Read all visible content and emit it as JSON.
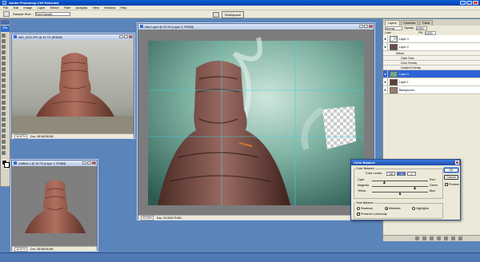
{
  "app": {
    "title": "Adobe Photoshop CS3 Extended"
  },
  "menu": [
    "File",
    "Edit",
    "Image",
    "Layer",
    "Select",
    "Filter",
    "Analysis",
    "View",
    "Window",
    "Help"
  ],
  "options": {
    "sample_size_label": "Sample Size:",
    "sample_size_value": "Point Sample",
    "workspace_label": "Workspace"
  },
  "toolbox": {
    "logo": "Ps"
  },
  "docs": {
    "doc1": {
      "title": "IMG_5233.JPG @ 16.7% (RGB/8)",
      "zoom": "16.67%",
      "status": "Doc: 38.5M/38.5M"
    },
    "doc2": {
      "title": "New Layer @ 33.3% (Layer 3, RGB/8)",
      "zoom": "33.33%",
      "status": "Doc: 26.0M/175.5M"
    },
    "doc3": {
      "title": "Untitled-1 @ 16.7% (Layer 1, RGB/8)",
      "zoom": "16.67%",
      "status": "Doc: 38.8M/38.8M"
    }
  },
  "layers_panel": {
    "tabs": [
      "Layers",
      "Channels",
      "Paths"
    ],
    "blend_mode": "Normal",
    "opacity_label": "Opacity:",
    "opacity_value": "100%",
    "lock_label": "Lock:",
    "fill_label": "Fill:",
    "fill_value": "100%",
    "layers": [
      {
        "name": "Layer 4"
      },
      {
        "name": "Layer 2"
      },
      {
        "name": "Effects"
      },
      {
        "name": "Outer Glow"
      },
      {
        "name": "Color Overlay"
      },
      {
        "name": "Gradient Overlay"
      },
      {
        "name": "Layer 3"
      },
      {
        "name": "Layer 1"
      },
      {
        "name": "Background"
      }
    ]
  },
  "color_balance": {
    "title": "Color Balance",
    "section_balance": "Color Balance",
    "levels_label": "Color Levels:",
    "levels": [
      "-56",
      "+53",
      "0"
    ],
    "left_labels": [
      "Cyan",
      "Magenta",
      "Yellow"
    ],
    "right_labels": [
      "Red",
      "Green",
      "Blue"
    ],
    "slider_values": [
      -56,
      53,
      0
    ],
    "ok": "OK",
    "cancel": "Cancel",
    "preview": "Preview",
    "tone_section": "Tone Balance",
    "tones": [
      "Shadows",
      "Midtones",
      "Highlights"
    ],
    "selected_tone": "Midtones",
    "preserve": "Preserve Luminosity"
  },
  "colors": {
    "desktop": "#5b85ba",
    "selection": "#2f64d6",
    "title_blue": "#0b5ed7"
  }
}
